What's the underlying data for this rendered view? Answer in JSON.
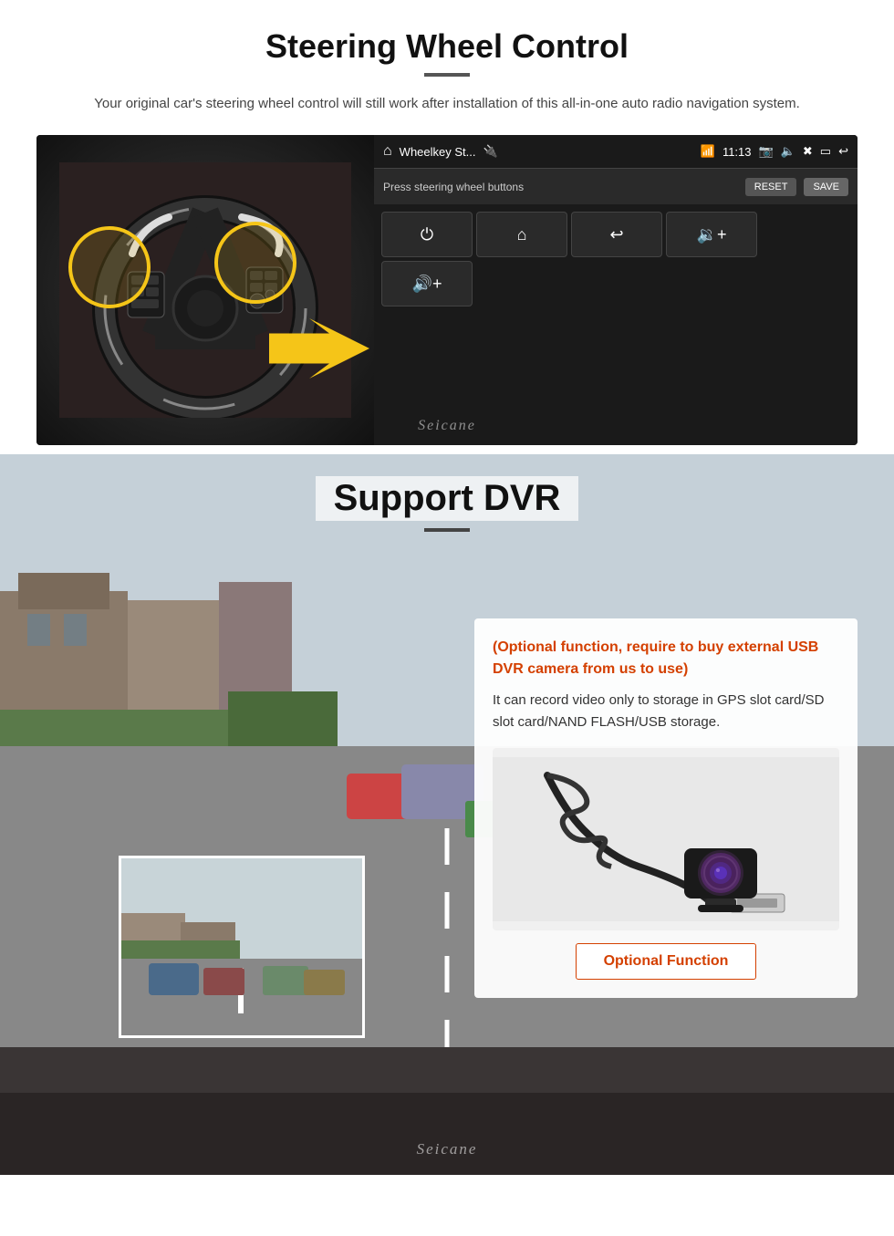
{
  "steering": {
    "title": "Steering Wheel Control",
    "description": "Your original car's steering wheel control will still work after installation of this all-in-one auto radio navigation system.",
    "ui": {
      "app_name": "Wheelkey St...",
      "time": "11:13",
      "prompt": "Press steering wheel buttons",
      "reset_label": "RESET",
      "save_label": "SAVE",
      "buttons": [
        "⏻",
        "⌂",
        "↩",
        "🔊+",
        "🔊+"
      ]
    },
    "watermark": "Seicane"
  },
  "dvr": {
    "title": "Support DVR",
    "card": {
      "optional_text": "(Optional function, require to buy external USB DVR camera from us to use)",
      "description": "It can record video only to storage in GPS slot card/SD slot card/NAND FLASH/USB storage.",
      "optional_function_label": "Optional Function"
    },
    "watermark": "Seicane"
  }
}
